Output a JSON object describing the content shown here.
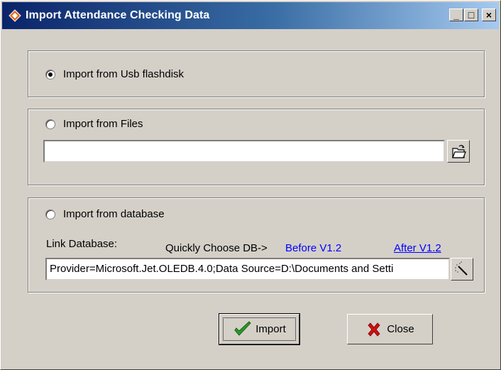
{
  "window": {
    "title": "Import Attendance Checking Data",
    "controls": {
      "minimize": "_",
      "maximize": "□",
      "close": "×"
    }
  },
  "options": {
    "usb": {
      "label": "Import from Usb flashdisk",
      "checked": true
    },
    "files": {
      "label": "Import from Files",
      "checked": false,
      "path_value": "",
      "browse_icon": "folder-open-icon"
    },
    "database": {
      "label": "Import from database",
      "checked": false,
      "link_label": "Link Database:",
      "quick_choose_label": "Quickly Choose DB->",
      "before_link": "Before V1.2",
      "after_link": "After V1.2",
      "connection_value": "Provider=Microsoft.Jet.OLEDB.4.0;Data Source=D:\\Documents and Setti",
      "build_icon": "magic-wand-icon"
    }
  },
  "buttons": {
    "import_label": "Import",
    "close_label": "Close"
  }
}
